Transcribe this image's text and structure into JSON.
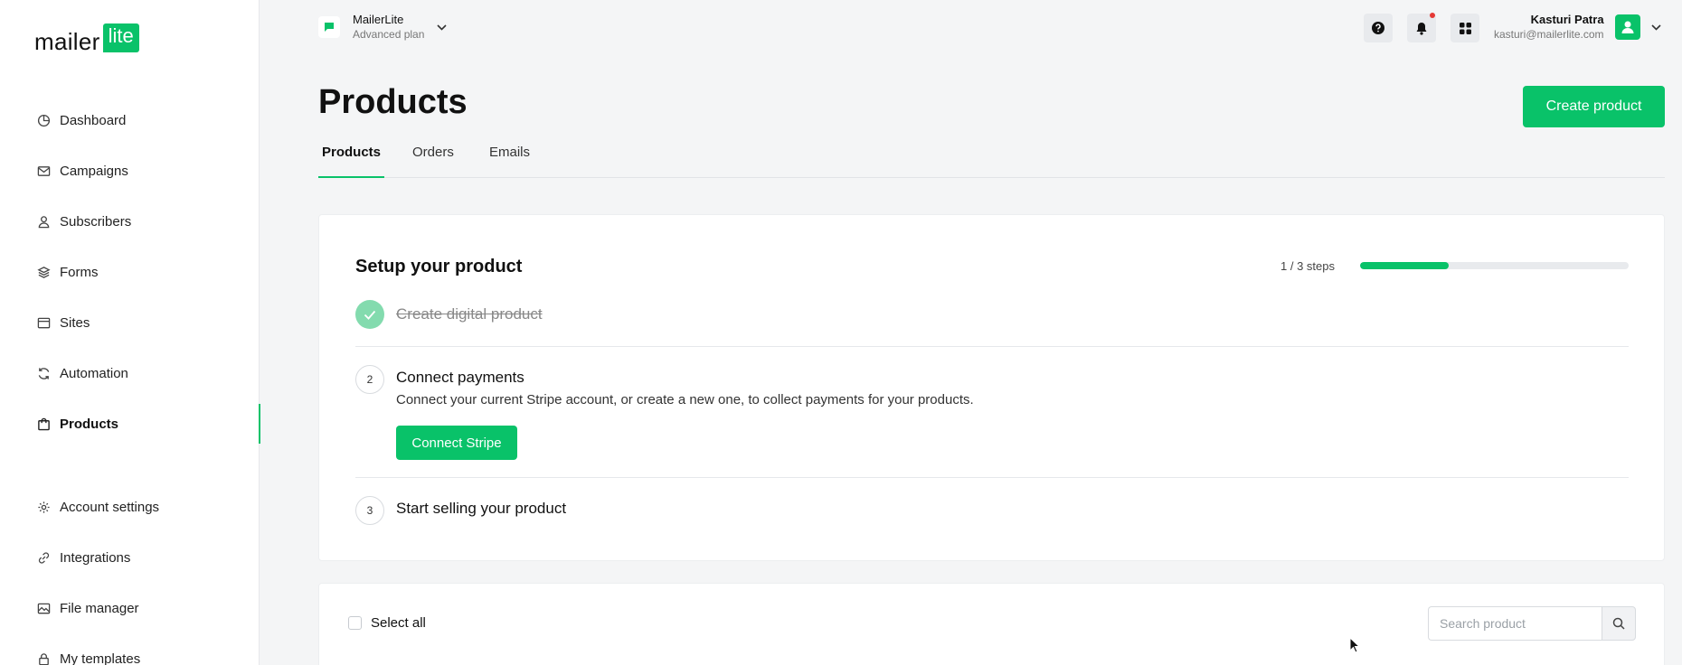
{
  "brand": {
    "logo_text": "mailer",
    "logo_badge": "lite",
    "accent": "#09c269"
  },
  "sidebar": {
    "items": [
      {
        "label": "Dashboard",
        "icon": "clock-icon"
      },
      {
        "label": "Campaigns",
        "icon": "mail-icon"
      },
      {
        "label": "Subscribers",
        "icon": "user-icon"
      },
      {
        "label": "Forms",
        "icon": "layers-icon"
      },
      {
        "label": "Sites",
        "icon": "browser-icon"
      },
      {
        "label": "Automation",
        "icon": "refresh-icon"
      },
      {
        "label": "Products",
        "icon": "bag-icon",
        "active": true
      },
      {
        "label": "Account settings",
        "icon": "gear-icon"
      },
      {
        "label": "Integrations",
        "icon": "link-icon"
      },
      {
        "label": "File manager",
        "icon": "image-icon"
      },
      {
        "label": "My templates",
        "icon": "lock-icon"
      }
    ]
  },
  "topbar": {
    "account_name": "MailerLite",
    "account_plan": "Advanced plan",
    "user_name": "Kasturi Patra",
    "user_email": "kasturi@mailerlite.com"
  },
  "header": {
    "title": "Products",
    "create_label": "Create product",
    "tabs": [
      {
        "label": "Products",
        "active": true
      },
      {
        "label": "Orders"
      },
      {
        "label": "Emails"
      }
    ]
  },
  "setup": {
    "title": "Setup your product",
    "steps_text": "1 / 3 steps",
    "progress": 0.33,
    "step1": "Create digital product",
    "step2_num": "2",
    "step2_title": "Connect payments",
    "step2_desc": "Connect your current Stripe account, or create a new one, to collect payments for your products.",
    "stripe_label": "Connect Stripe",
    "step3_num": "3",
    "step3_title": "Start selling your product"
  },
  "list": {
    "select_all": "Select all",
    "search_placeholder": "Search product"
  }
}
